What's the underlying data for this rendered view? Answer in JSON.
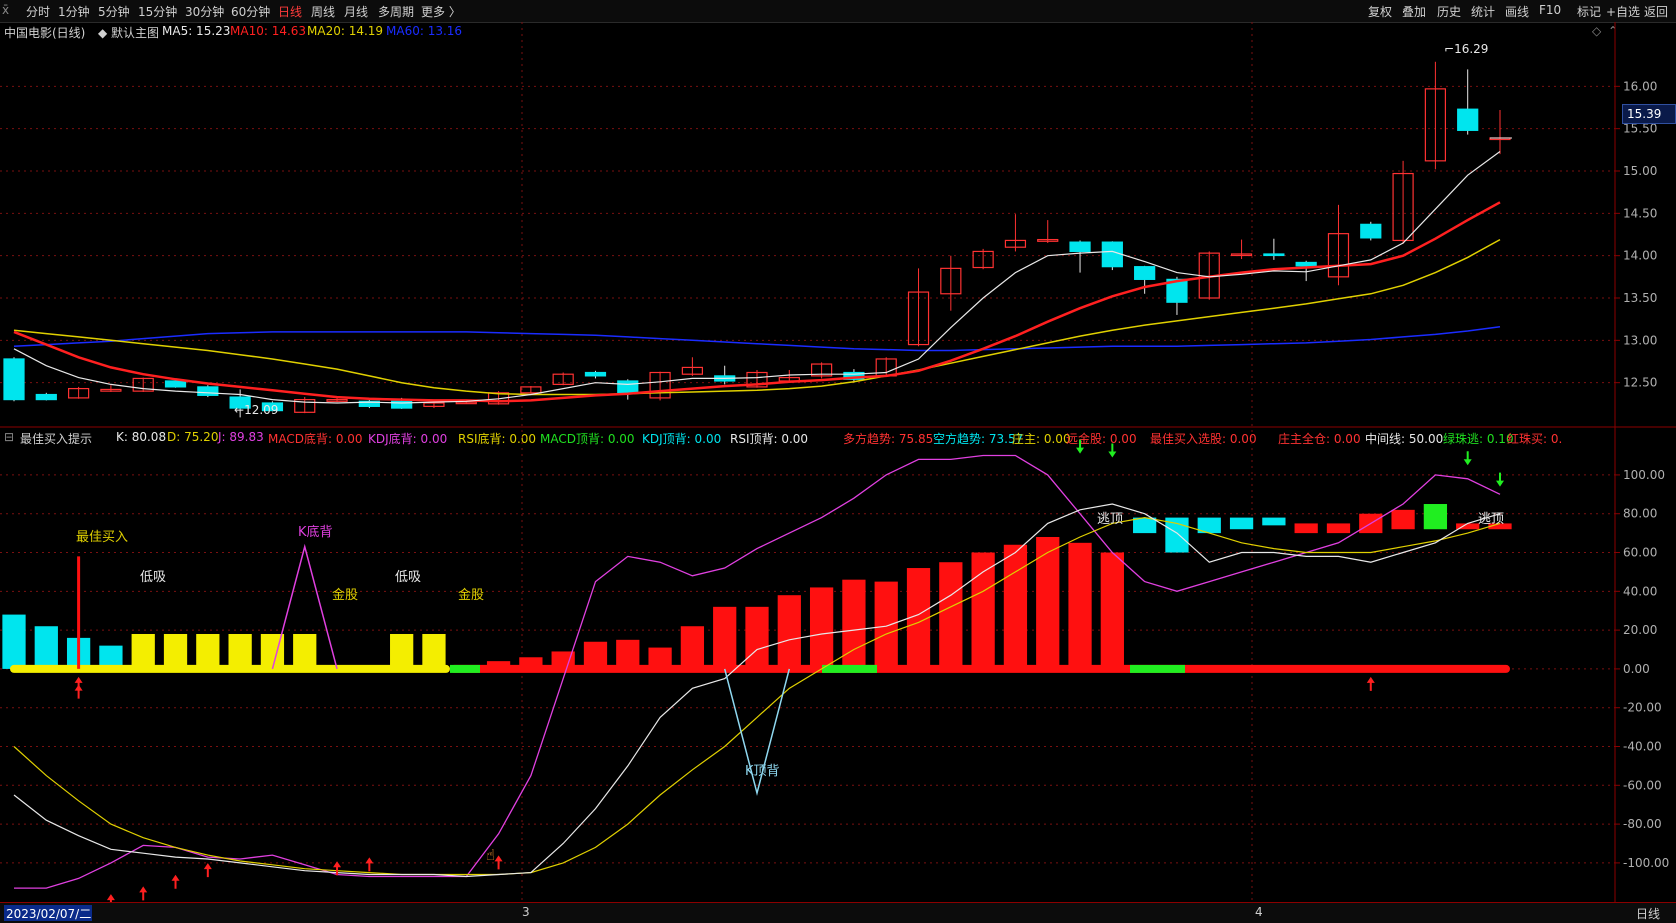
{
  "toolbar": {
    "menu_glyph": "x̄",
    "periods": [
      "分时",
      "1分钟",
      "5分钟",
      "15分钟",
      "30分钟",
      "60分钟",
      "日线",
      "周线",
      "月线",
      "多周期",
      "更多 〉"
    ],
    "active_period": "日线",
    "right_buttons": [
      "复权",
      "叠加",
      "历史",
      "统计",
      "画线",
      "F10",
      "+自选",
      "返回"
    ],
    "mark_label": "标记"
  },
  "main_legend": {
    "stock": "中国电影(日线)",
    "template": "默认主图",
    "ma5": "MA5: 15.23",
    "ma10": "MA10: 14.63",
    "ma20": "MA20: 14.19",
    "ma60": "MA60: 13.16"
  },
  "colors": {
    "up": "#ff3232",
    "down": "#00e5ee",
    "ma5": "#e8e8e8",
    "ma10": "#ff2020",
    "ma20": "#e0d000",
    "ma60": "#1a2cff",
    "grid": "#7a1010",
    "axis": "#8b0000"
  },
  "indicator_legend": {
    "name": "最佳买入提示",
    "items": [
      {
        "text": "K: 80.08",
        "color": "#e8e8e8"
      },
      {
        "text": "D: 75.20",
        "color": "#e0d000"
      },
      {
        "text": "J: 89.83",
        "color": "#e040e0"
      },
      {
        "text": "MACD底背: 0.00",
        "color": "#ff3232"
      },
      {
        "text": "KDJ底背: 0.00",
        "color": "#e040e0"
      },
      {
        "text": "RSI底背: 0.00",
        "color": "#e0d000"
      },
      {
        "text": "MACD顶背: 0.00",
        "color": "#20e020"
      },
      {
        "text": "KDJ顶背: 0.00",
        "color": "#00e5ee"
      },
      {
        "text": "RSI顶背: 0.00",
        "color": "#e8e8e8"
      },
      {
        "text": "多方趋势: 75.85",
        "color": "#ff3232"
      },
      {
        "text": "空方趋势: 73.57",
        "color": "#00e5ee"
      },
      {
        "text": "庄主: 0.00",
        "color": "#e0d000"
      },
      {
        "text": "远金股: 0.00",
        "color": "#ff3232"
      },
      {
        "text": "最佳买入选股: 0.00",
        "color": "#ff3232"
      },
      {
        "text": "庄主全仓: 0.00",
        "color": "#ff3232"
      },
      {
        "text": "中间线: 50.00",
        "color": "#e8e8e8"
      },
      {
        "text": "绿珠逃: 0.10",
        "color": "#20e020"
      },
      {
        "text": "红珠买: 0.",
        "color": "#ff3232"
      }
    ]
  },
  "annotations": {
    "best_buy": "最佳买入",
    "low_buy_1": "低吸",
    "low_buy_2": "低吸",
    "k_bottom": "K底背",
    "gold_1": "金股",
    "gold_2": "金股",
    "k_top": "K顶背",
    "escape_1": "逃顶",
    "escape_2": "逃顶",
    "high_mark": "16.29",
    "low_mark": "12.09"
  },
  "price_axis": {
    "ticks": [
      "16.00",
      "15.50",
      "15.00",
      "14.50",
      "14.00",
      "13.50",
      "13.00",
      "12.50"
    ],
    "current": "15.39"
  },
  "indicator_axis": {
    "ticks": [
      "100.00",
      "80.00",
      "60.00",
      "40.00",
      "20.00",
      "0.00",
      "-20.00",
      "-40.00",
      "-60.00",
      "-80.00",
      "-100.00"
    ]
  },
  "bottom_bar": {
    "date": "2023/02/07/二",
    "month_3": "3",
    "month_4": "4",
    "period": "日线"
  },
  "chart_data": {
    "type": "candlestick",
    "ylim": [
      12.0,
      16.5
    ],
    "candles": [
      [
        12.78,
        12.3,
        12.8,
        12.28
      ],
      [
        12.36,
        12.3,
        12.38,
        12.29
      ],
      [
        12.32,
        12.43,
        12.45,
        12.31
      ],
      [
        12.4,
        12.42,
        12.47,
        12.39
      ],
      [
        12.4,
        12.55,
        12.56,
        12.39
      ],
      [
        12.52,
        12.45,
        12.53,
        12.44
      ],
      [
        12.45,
        12.35,
        12.47,
        12.33
      ],
      [
        12.33,
        12.2,
        12.42,
        12.09
      ],
      [
        12.26,
        12.17,
        12.28,
        12.16
      ],
      [
        12.15,
        12.3,
        12.33,
        12.14
      ],
      [
        12.28,
        12.3,
        12.33,
        12.27
      ],
      [
        12.28,
        12.22,
        12.3,
        12.2
      ],
      [
        12.28,
        12.2,
        12.32,
        12.19
      ],
      [
        12.22,
        12.26,
        12.28,
        12.2
      ],
      [
        12.27,
        12.27,
        12.29,
        12.25
      ],
      [
        12.25,
        12.38,
        12.4,
        12.24
      ],
      [
        12.38,
        12.45,
        12.46,
        12.37
      ],
      [
        12.48,
        12.6,
        12.62,
        12.47
      ],
      [
        12.62,
        12.58,
        12.64,
        12.55
      ],
      [
        12.52,
        12.38,
        12.54,
        12.3
      ],
      [
        12.32,
        12.62,
        12.63,
        12.29
      ],
      [
        12.6,
        12.68,
        12.8,
        12.58
      ],
      [
        12.58,
        12.52,
        12.7,
        12.48
      ],
      [
        12.45,
        12.62,
        12.65,
        12.44
      ],
      [
        12.52,
        12.56,
        12.65,
        12.5
      ],
      [
        12.58,
        12.72,
        12.74,
        12.55
      ],
      [
        12.62,
        12.54,
        12.66,
        12.5
      ],
      [
        12.58,
        12.78,
        12.8,
        12.57
      ],
      [
        12.95,
        13.57,
        13.85,
        12.93
      ],
      [
        13.55,
        13.85,
        14.0,
        13.35
      ],
      [
        13.86,
        14.05,
        14.08,
        13.84
      ],
      [
        14.1,
        14.18,
        14.49,
        14.05
      ],
      [
        14.17,
        14.19,
        14.42,
        14.15
      ],
      [
        14.16,
        14.05,
        14.18,
        13.8
      ],
      [
        14.16,
        13.87,
        14.17,
        13.83
      ],
      [
        13.87,
        13.72,
        13.88,
        13.55
      ],
      [
        13.72,
        13.45,
        13.75,
        13.3
      ],
      [
        13.5,
        14.03,
        14.05,
        13.48
      ],
      [
        14.02,
        14.02,
        14.19,
        13.96
      ],
      [
        14.02,
        14.01,
        14.2,
        13.95
      ],
      [
        13.92,
        13.88,
        13.94,
        13.7
      ],
      [
        13.75,
        14.26,
        14.6,
        13.65
      ],
      [
        14.37,
        14.21,
        14.4,
        14.18
      ],
      [
        14.18,
        14.97,
        15.12,
        14.14
      ],
      [
        15.12,
        15.97,
        16.29,
        15.02
      ],
      [
        15.73,
        15.48,
        16.2,
        15.43
      ],
      [
        15.38,
        15.39,
        15.72,
        15.2
      ]
    ],
    "ma5": [
      12.9,
      12.7,
      12.56,
      12.48,
      12.43,
      12.4,
      12.38,
      12.36,
      12.3,
      12.27,
      12.26,
      12.27,
      12.26,
      12.27,
      12.28,
      12.31,
      12.36,
      12.43,
      12.5,
      12.48,
      12.51,
      12.55,
      12.55,
      12.56,
      12.59,
      12.6,
      12.6,
      12.62,
      12.78,
      13.15,
      13.5,
      13.8,
      14.0,
      14.03,
      14.05,
      13.93,
      13.8,
      13.75,
      13.78,
      13.82,
      13.81,
      13.88,
      13.95,
      14.15,
      14.55,
      14.95,
      15.23
    ],
    "ma10": [
      13.1,
      12.95,
      12.8,
      12.68,
      12.6,
      12.54,
      12.49,
      12.45,
      12.41,
      12.37,
      12.33,
      12.31,
      12.3,
      12.29,
      12.29,
      12.28,
      12.29,
      12.32,
      12.35,
      12.37,
      12.4,
      12.43,
      12.46,
      12.48,
      12.51,
      12.53,
      12.56,
      12.58,
      12.64,
      12.76,
      12.9,
      13.05,
      13.22,
      13.38,
      13.52,
      13.63,
      13.7,
      13.75,
      13.8,
      13.84,
      13.86,
      13.88,
      13.9,
      14.0,
      14.2,
      14.42,
      14.63
    ],
    "ma20": [
      13.12,
      13.08,
      13.04,
      13.0,
      12.96,
      12.92,
      12.88,
      12.83,
      12.78,
      12.72,
      12.66,
      12.58,
      12.5,
      12.44,
      12.4,
      12.37,
      12.36,
      12.36,
      12.36,
      12.37,
      12.38,
      12.39,
      12.4,
      12.41,
      12.43,
      12.46,
      12.51,
      12.58,
      12.65,
      12.73,
      12.81,
      12.89,
      12.97,
      13.05,
      13.12,
      13.18,
      13.23,
      13.28,
      13.33,
      13.38,
      13.43,
      13.49,
      13.55,
      13.65,
      13.8,
      13.98,
      14.19
    ],
    "ma60": [
      12.93,
      12.95,
      12.97,
      12.99,
      13.02,
      13.05,
      13.08,
      13.09,
      13.1,
      13.1,
      13.1,
      13.1,
      13.1,
      13.1,
      13.1,
      13.09,
      13.08,
      13.07,
      13.06,
      13.04,
      13.02,
      13.0,
      12.98,
      12.96,
      12.94,
      12.92,
      12.9,
      12.89,
      12.88,
      12.88,
      12.89,
      12.9,
      12.91,
      12.92,
      12.93,
      12.93,
      12.93,
      12.94,
      12.95,
      12.96,
      12.97,
      12.99,
      13.01,
      13.04,
      13.07,
      13.11,
      13.16
    ],
    "ind_ylim": [
      -115,
      118
    ],
    "bars": [
      {
        "v": 28,
        "c": "c"
      },
      {
        "v": 22,
        "c": "c"
      },
      {
        "v": 16,
        "c": "c"
      },
      {
        "v": 12,
        "c": "c"
      },
      {
        "v": 18,
        "c": "y"
      },
      {
        "v": 18,
        "c": "y"
      },
      {
        "v": 18,
        "c": "y"
      },
      {
        "v": 18,
        "c": "y"
      },
      {
        "v": 18,
        "c": "y"
      },
      {
        "v": 18,
        "c": "y"
      },
      {
        "v": 2,
        "c": "y"
      },
      {
        "v": 2,
        "c": "r"
      },
      {
        "v": 18,
        "c": "y"
      },
      {
        "v": 18,
        "c": "y"
      },
      {
        "v": 2,
        "c": "r"
      },
      {
        "v": 4,
        "c": "r"
      },
      {
        "v": 6,
        "c": "r"
      },
      {
        "v": 9,
        "c": "r"
      },
      {
        "v": 14,
        "c": "r"
      },
      {
        "v": 15,
        "c": "r"
      },
      {
        "v": 11,
        "c": "r"
      },
      {
        "v": 22,
        "c": "r"
      },
      {
        "v": 32,
        "c": "r"
      },
      {
        "v": 32,
        "c": "r"
      },
      {
        "v": 38,
        "c": "r"
      },
      {
        "v": 42,
        "c": "r"
      },
      {
        "v": 46,
        "c": "r"
      },
      {
        "v": 45,
        "c": "r"
      },
      {
        "v": 52,
        "c": "r"
      },
      {
        "v": 55,
        "c": "r"
      },
      {
        "v": 60,
        "c": "r"
      },
      {
        "v": 64,
        "c": "r"
      },
      {
        "v": 68,
        "c": "r"
      },
      {
        "v": 65,
        "c": "r"
      },
      {
        "v": 60,
        "c": "r"
      },
      {
        "v": 70,
        "c": "c",
        "b": 78
      },
      {
        "v": 60,
        "c": "c",
        "b": 78
      },
      {
        "v": 70,
        "c": "c",
        "b": 78
      },
      {
        "v": 72,
        "c": "c",
        "b": 78
      },
      {
        "v": 74,
        "c": "c",
        "b": 78
      },
      {
        "v": 75,
        "c": "r",
        "b": 70
      },
      {
        "v": 75,
        "c": "r",
        "b": 70
      },
      {
        "v": 70,
        "c": "r",
        "b": 80
      },
      {
        "v": 72,
        "c": "r",
        "b": 82
      },
      {
        "v": 72,
        "c": "g",
        "b": 85
      },
      {
        "v": 72,
        "c": "r",
        "b": 75
      },
      {
        "v": 72,
        "c": "r",
        "b": 75
      }
    ],
    "K": [
      -65,
      -78,
      -86,
      -93,
      -95,
      -97,
      -98,
      -100,
      -102,
      -104,
      -105,
      -106,
      -106,
      -106,
      -107,
      -106,
      -105,
      -90,
      -72,
      -50,
      -25,
      -10,
      -5,
      10,
      15,
      18,
      20,
      22,
      28,
      38,
      50,
      60,
      75,
      82,
      85,
      80,
      70,
      55,
      60,
      60,
      58,
      58,
      55,
      60,
      65,
      75,
      80
    ],
    "D": [
      -40,
      -55,
      -68,
      -80,
      -87,
      -92,
      -96,
      -99,
      -101,
      -103,
      -104,
      -105,
      -106,
      -106,
      -106,
      -106,
      -105,
      -100,
      -92,
      -80,
      -65,
      -52,
      -40,
      -25,
      -10,
      0,
      10,
      18,
      24,
      32,
      40,
      50,
      60,
      68,
      75,
      78,
      75,
      70,
      65,
      62,
      60,
      60,
      60,
      63,
      66,
      70,
      75
    ],
    "J": [
      -113,
      -113,
      -108,
      -100,
      -91,
      -92,
      -97,
      -98,
      -96,
      -101,
      -106,
      -107,
      -107,
      -107,
      -107,
      -85,
      -55,
      -5,
      45,
      58,
      55,
      48,
      52,
      62,
      70,
      78,
      88,
      100,
      108,
      108,
      110,
      110,
      100,
      80,
      60,
      45,
      40,
      45,
      50,
      55,
      60,
      65,
      75,
      85,
      100,
      98,
      90
    ]
  }
}
